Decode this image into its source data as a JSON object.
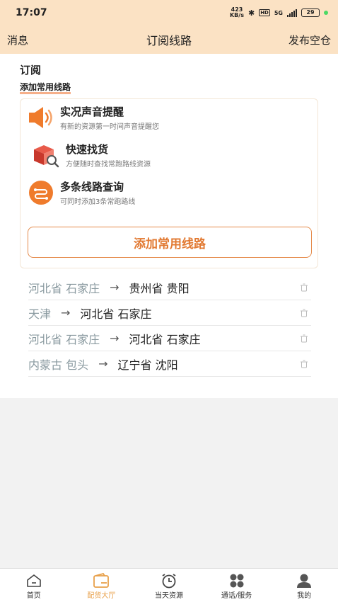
{
  "status_bar": {
    "time": "17:07",
    "speed_top": "423",
    "speed_bottom": "KB/s",
    "network": "5G",
    "battery": "29"
  },
  "nav": {
    "left": "消息",
    "title": "订阅线路",
    "right": "发布空仓"
  },
  "section": {
    "title": "订阅",
    "subtitle": "添加常用线路"
  },
  "features": [
    {
      "name": "实况声音提醒",
      "desc": "有新的资源第一时间声音提醒您",
      "icon": "speaker-icon"
    },
    {
      "name": "快速找货",
      "desc": "方便随时查找常跑路线资源",
      "icon": "box-search-icon"
    },
    {
      "name": "多条线路查询",
      "desc": "可同时添加3条常跑路线",
      "icon": "route-icon"
    }
  ],
  "add_button": "添加常用线路",
  "routes": [
    {
      "from": "河北省 石家庄",
      "arrow": "→",
      "to": "贵州省 贵阳"
    },
    {
      "from": "天津",
      "arrow": "→",
      "to": "河北省 石家庄"
    },
    {
      "from": "河北省 石家庄",
      "arrow": "→",
      "to": "河北省 石家庄"
    },
    {
      "from": "内蒙古 包头",
      "arrow": "→",
      "to": "辽宁省 沈阳"
    }
  ],
  "tabs": [
    {
      "label": "首页",
      "icon": "home-icon",
      "active": false
    },
    {
      "label": "配货大厅",
      "icon": "wallet-icon",
      "active": true
    },
    {
      "label": "当天资源",
      "icon": "clock-icon",
      "active": false
    },
    {
      "label": "通话/服务",
      "icon": "grid-icon",
      "active": false
    },
    {
      "label": "我的",
      "icon": "user-icon",
      "active": false
    }
  ],
  "colors": {
    "header_bg": "#fbe2c4",
    "accent": "#e27a33",
    "tab_active": "#e8a04a"
  }
}
